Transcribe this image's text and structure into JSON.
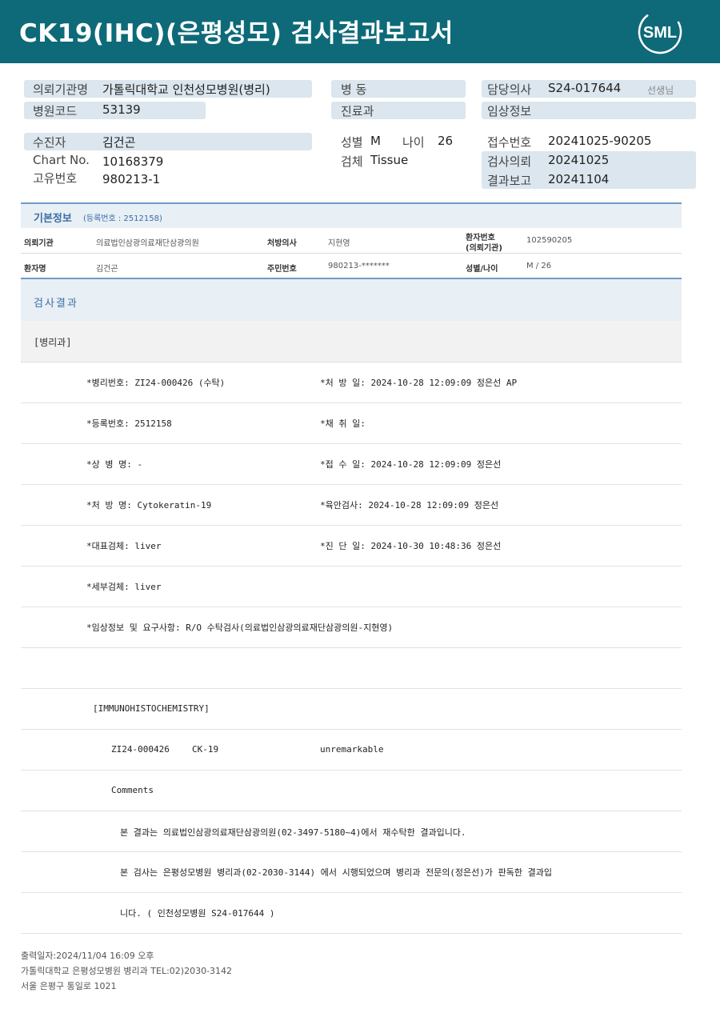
{
  "header": {
    "title": "CK19(IHC)(은평성모) 검사결과보고서",
    "logo_text": "SML",
    "colors": {
      "bar": "#0e6a78",
      "pill": "#dbe6ee",
      "accent": "#3a6ea5"
    }
  },
  "top": {
    "institution_label": "의뢰기관명",
    "institution_value": "가톨릭대학교 인천성모병원(병리)",
    "hospital_code_label": "병원코드",
    "hospital_code_value": "53139",
    "patient_label": "수진자",
    "patient_value": "김건곤",
    "chart_label": "Chart No.",
    "chart_value": "10168379",
    "unique_label": "고유번호",
    "unique_value": "980213-1",
    "ward_label": "병 동",
    "dept_label": "진료과",
    "sex_label": "성별",
    "sex_value": "M",
    "age_label": "나이",
    "age_value": "26",
    "specimen_label": "검체",
    "specimen_value": "Tissue",
    "doctor_label": "담당의사",
    "doctor_value": "S24-017644",
    "doctor_suffix": "선생님",
    "clinical_label": "임상정보",
    "receipt_label": "접수번호",
    "receipt_value": "20241025-90205",
    "request_label": "검사의뢰",
    "request_value": "20241025",
    "report_label": "결과보고",
    "report_value": "20241104"
  },
  "basic": {
    "title": "기본정보",
    "reg_note": "(등록번호 : 2512158)",
    "inst_key": "의뢰기관",
    "inst_val": "의료법인삼광의료재단삼광의원",
    "doctor_key": "처방의사",
    "doctor_val": "지현영",
    "pid_key_1": "환자번호",
    "pid_key_2": "(의뢰기관)",
    "pid_val": "102590205",
    "name_key": "환자명",
    "name_val": "김건곤",
    "rrn_key": "주민번호",
    "rrn_val": "980213-*******",
    "sexage_key": "성별/나이",
    "sexage_val": "M / 26"
  },
  "result": {
    "title": "검사결과",
    "dept": "[병리과]",
    "rows": [
      {
        "left": "*병리번호: ZI24-000426 (수탁)",
        "right": "*처 방 일: 2024-10-28 12:09:09  정은선 AP"
      },
      {
        "left": "*등록번호: 2512158",
        "right": "*채 취 일:"
      },
      {
        "left": "*상 병 명: -",
        "right": "*접 수 일: 2024-10-28 12:09:09  정은선"
      },
      {
        "left": "*처 방 명: Cytokeratin-19",
        "right": "*육안검사: 2024-10-28 12:09:09  정은선"
      },
      {
        "left": "*대표검체: liver",
        "right": "*진 단 일: 2024-10-30 10:48:36  정은선"
      },
      {
        "left": "*세부검체: liver",
        "right": ""
      },
      {
        "left": "*임상정보 및 요구사항: R/O 수탁검사(의료법인삼광의료재단삼광의원-지현영)",
        "right": ""
      }
    ],
    "ihc_header": "[IMMUNOHISTOCHEMISTRY]",
    "ihc_no": "ZI24-000426",
    "ihc_marker": "CK-19",
    "ihc_result": "unremarkable",
    "comments_label": "Comments",
    "comment_1": "본 결과는 의료법인삼광의료재단삼광의원(02-3497-5180~4)에서 재수탁한 결과입니다.",
    "comment_2": "본 검사는 은평성모병원 병리과(02-2030-3144) 에서 시행되었으며 병리과 전문의(정은선)가 판독한 결과입",
    "comment_3": "니다. ( 인천성모병원 S24-017644 )"
  },
  "footer": {
    "line1": "출력일자:2024/11/04 16:09 오후",
    "line2": "가톨릭대학교 은평성모병원 병리과 TEL:02)2030-3142",
    "line3": "서울 은평구 통일로 1021"
  }
}
